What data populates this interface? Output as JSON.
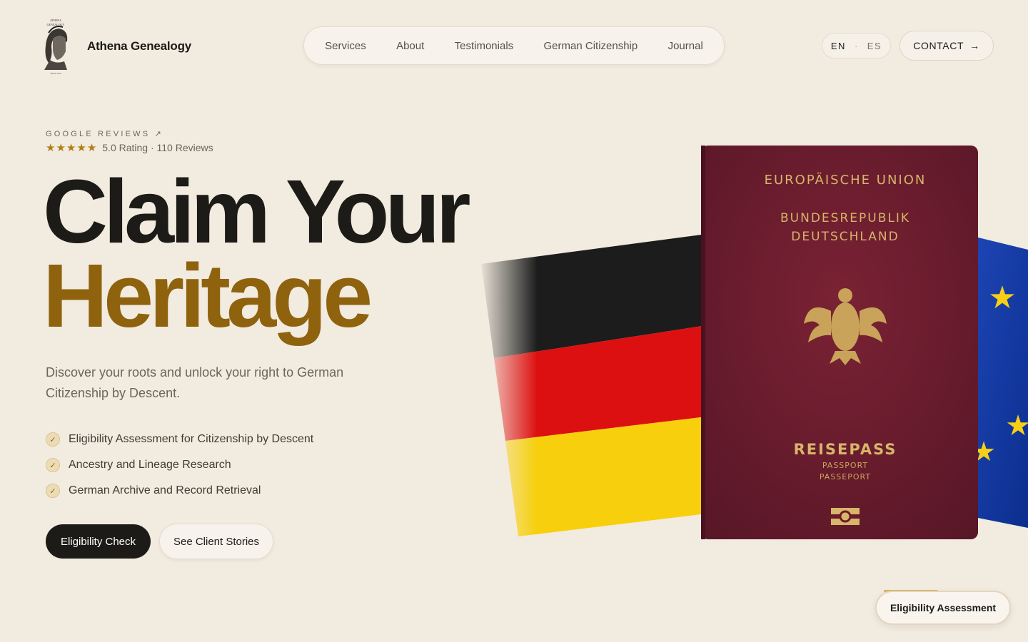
{
  "brand": {
    "name": "Athena Genealogy",
    "logo_text_top": "ATHENA GENEALOGY",
    "logo_text_bottom": "SINCE 2019"
  },
  "nav": {
    "items": [
      "Services",
      "About",
      "Testimonials",
      "German Citizenship",
      "Journal"
    ]
  },
  "lang": {
    "active": "EN",
    "other": "ES",
    "separator": "·"
  },
  "contact": {
    "label": "CONTACT",
    "icon": "arrow-right-icon"
  },
  "reviews": {
    "label": "GOOGLE REVIEWS ↗",
    "stars": 5,
    "text": "5.0 Rating · 110 Reviews"
  },
  "hero": {
    "line1": "Claim Your",
    "line2": "Heritage",
    "subtitle": "Discover your roots and unlock your right to German Citizenship by Descent.",
    "features": [
      "Eligibility Assessment for Citizenship by Descent",
      "Ancestry and Lineage Research",
      "German Archive and Record Retrieval"
    ],
    "primary_cta": "Eligibility Check",
    "secondary_cta": "See Client Stories"
  },
  "passport": {
    "union": "EUROPÄISCHE UNION",
    "country_line1": "BUNDESREPUBLIK",
    "country_line2": "DEUTSCHLAND",
    "title": "REISEPASS",
    "sub1": "PASSPORT",
    "sub2": "PASSEPORT"
  },
  "floating_cta": "Eligibility Assessment",
  "colors": {
    "background": "#f2ebdf",
    "accent_gold": "#8f620e",
    "dark": "#1d1b18",
    "passport": "#6b1a2a"
  }
}
